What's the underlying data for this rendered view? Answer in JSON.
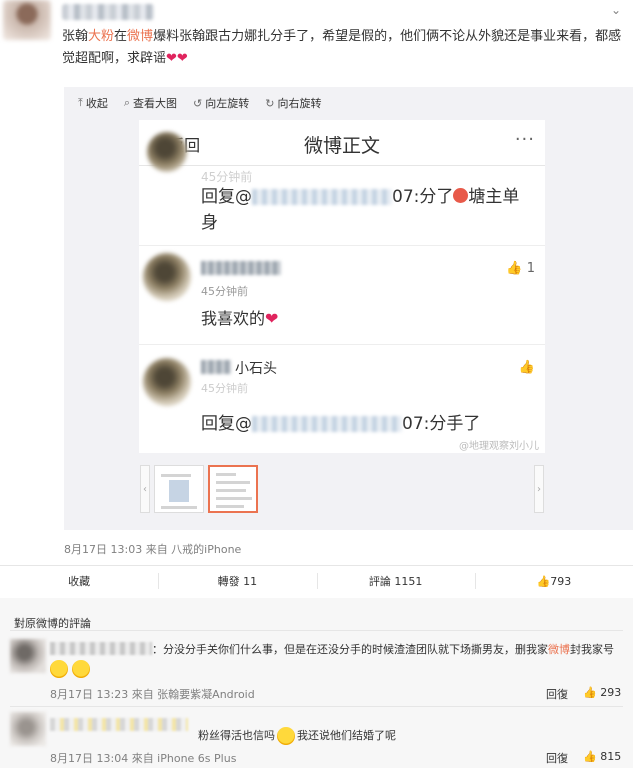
{
  "post": {
    "more_arrow": "⌄",
    "text_prefix": "张翰",
    "text_fan": "大粉",
    "text_mid1": "在",
    "text_weibo": "微博",
    "text_rest": "爆料张翰跟古力娜扎分手了，希望是假的，他们俩不论从外貌还是事业来看，都感觉超配啊，求辟谣",
    "hearts": "❤❤"
  },
  "viewer": {
    "toolbar": [
      {
        "icon": "⤒",
        "label": "收起"
      },
      {
        "icon": "⌕",
        "label": "查看大图"
      },
      {
        "icon": "↺",
        "label": "向左旋转"
      },
      {
        "icon": "↻",
        "label": "向右旋转"
      }
    ],
    "screenshot": {
      "back": "〈 返回",
      "title": "微博正文",
      "dots": "···",
      "c1_time": "45分钟前",
      "c1_reply_a": "回复@",
      "c1_reply_b": "07:分了",
      "c1_reply_c": "塘主单身",
      "c2_time": "45分钟前",
      "c2_text": "我喜欢的",
      "c2_heart": "❤",
      "c2_like": "👍 1",
      "c3_name": "小石头",
      "c3_time": "45分钟前",
      "c3_reply_a": "回复@",
      "c3_reply_b": "07:分手了",
      "c3_like": "👍",
      "watermark": "@地理观察刘小儿"
    },
    "thumb_left": "‹",
    "thumb_right": "›"
  },
  "meta": "8月17日 13:03 来自 八戒的iPhone",
  "actions": [
    {
      "label": "收藏"
    },
    {
      "label": "轉發 11"
    },
    {
      "label": "評論 1151"
    },
    {
      "label": "👍793"
    }
  ],
  "comments_header": "對原微博的評論",
  "comments": [
    {
      "text_a": "：分没分手关你们什么事，但是在还没分手的时候渣渣团队就下场撕男友，删我家",
      "text_weibo": "微博",
      "text_b": "封我家号",
      "meta": "8月17日 13:23 來自 张翰要紫凝Android",
      "reply": "回復",
      "likes": "👍 293"
    },
    {
      "text_a": "粉丝得活也信吗",
      "text_b": "我还说他们结婚了呢",
      "meta": "8月17日 13:04 來自 iPhone 6s Plus",
      "reply": "回復",
      "likes": "👍 815"
    }
  ],
  "colors": {
    "highlight": "#eb7350",
    "heart": "#e0245e",
    "meta": "#808080"
  }
}
